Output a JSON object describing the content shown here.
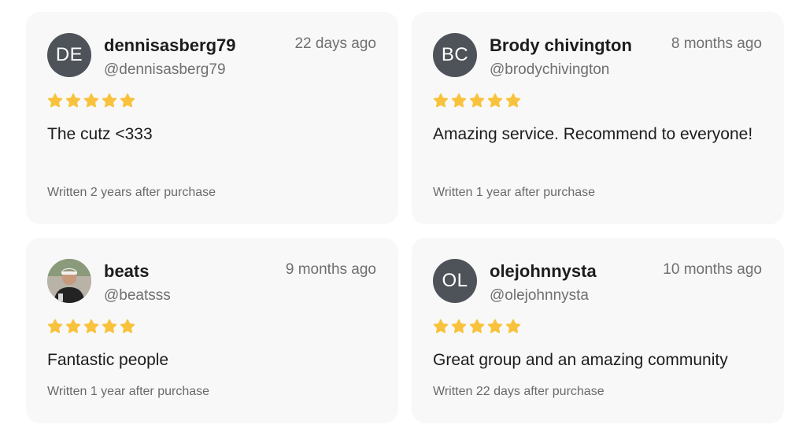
{
  "colors": {
    "card_background": "#f8f8f8",
    "avatar_background": "#4e5359",
    "star": "#f9c23c"
  },
  "reviews": [
    {
      "initials": "DE",
      "name": "dennisasberg79",
      "handle": "@dennisasberg79",
      "time": "22 days ago",
      "rating": 5,
      "text": "The cutz <333",
      "written": "Written 2 years after purchase"
    },
    {
      "initials": "BC",
      "name": "Brody chivington",
      "handle": "@brodychivington",
      "time": "8 months ago",
      "rating": 5,
      "text": "Amazing service. Recommend to everyone!",
      "written": "Written 1 year after purchase"
    },
    {
      "initials": "",
      "avatar_icon": "user-photo",
      "name": "beats",
      "handle": "@beatsss",
      "time": "9 months ago",
      "rating": 5,
      "text": "Fantastic people",
      "written": "Written 1 year after purchase"
    },
    {
      "initials": "OL",
      "name": "olejohnnysta",
      "handle": "@olejohnnysta",
      "time": "10 months ago",
      "rating": 5,
      "text": "Great group and an amazing community",
      "written": "Written 22 days after purchase"
    }
  ]
}
